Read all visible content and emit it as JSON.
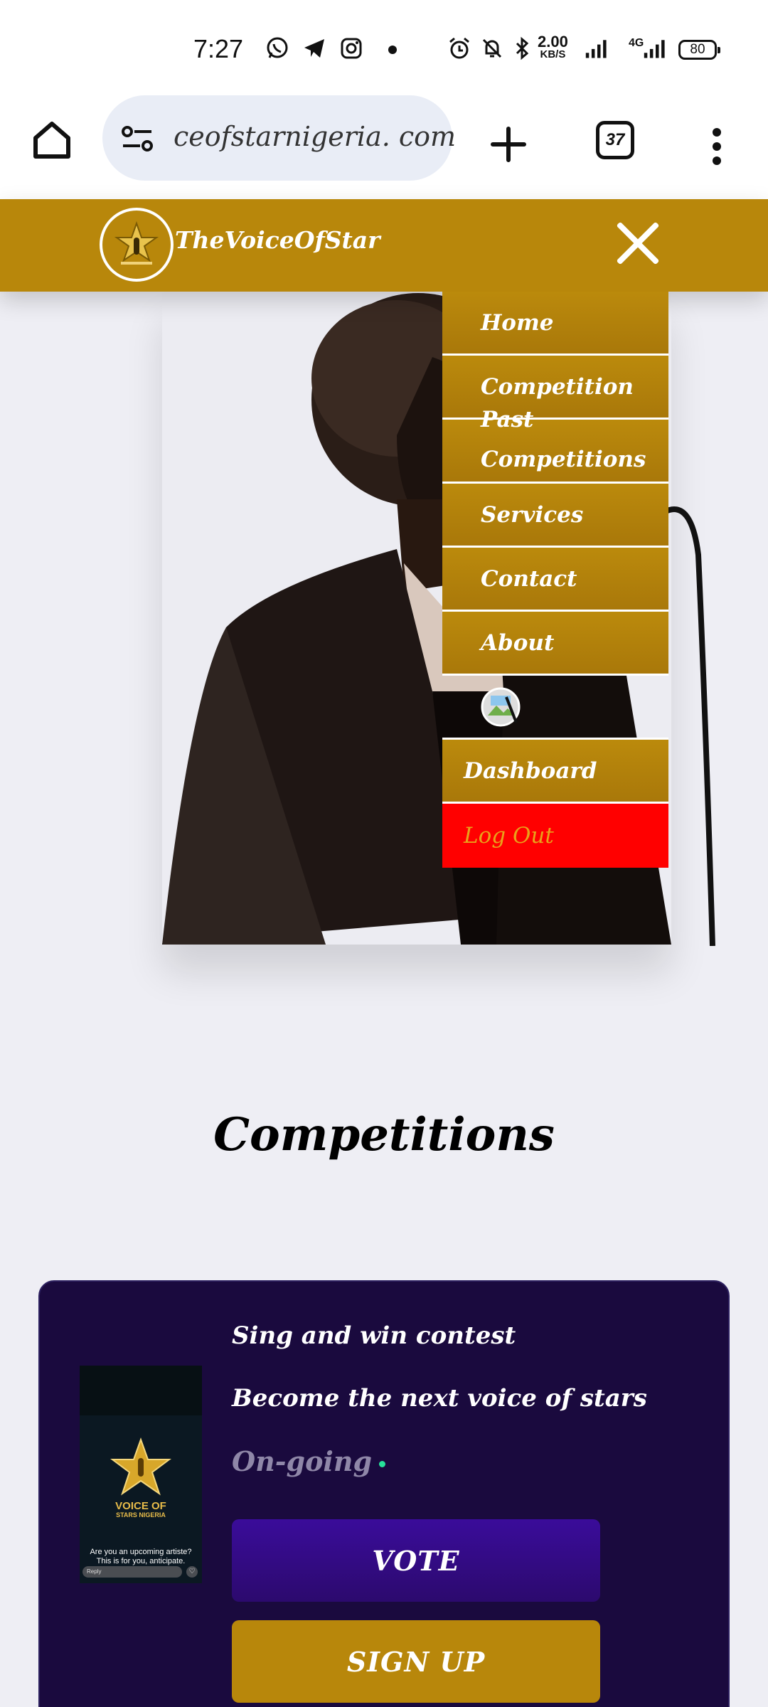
{
  "status_bar": {
    "time": "7:27",
    "speed_value": "2.00",
    "speed_unit": "KB/S",
    "network": "4G",
    "battery": "80",
    "icons": [
      "whatsapp-icon",
      "telegram-icon",
      "instagram-icon",
      "alarm-icon",
      "mute-icon",
      "bluetooth-icon",
      "signal-icon"
    ]
  },
  "browser": {
    "url": "ceofstarnigeria. com",
    "tab_count": "37"
  },
  "header": {
    "brand": "TheVoiceOfStar"
  },
  "menu": {
    "items": [
      {
        "label": "Home"
      },
      {
        "label": "Competition"
      },
      {
        "label_line1": "Past",
        "label_line2": "Competitions"
      },
      {
        "label": "Services"
      },
      {
        "label": "Contact"
      },
      {
        "label": "About"
      }
    ],
    "dashboard": "Dashboard",
    "logout": "Log Out"
  },
  "competitions": {
    "title": "Competitions",
    "card": {
      "title": "Sing and win contest",
      "subtitle": "Become the next voice of stars",
      "status": "On-going",
      "vote_label": "VOTE",
      "signup_label": "SIGN UP",
      "thumb_title_1": "VOICE OF",
      "thumb_title_2": "STARS NIGERIA",
      "thumb_caption": "Are you an upcoming artiste? This is for you, anticipate.",
      "thumb_reply": "Reply"
    }
  },
  "colors": {
    "brand_gold": "#b8870b",
    "logout_red": "#ff0000",
    "card_bg": "#1a0a3e",
    "vote_purple": "#3a0c9a"
  }
}
